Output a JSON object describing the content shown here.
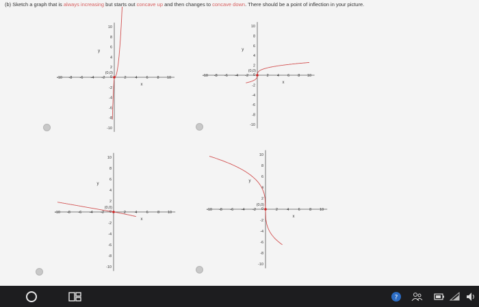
{
  "question": {
    "prefix": "(b) Sketch a graph that is ",
    "part1": "always increasing",
    "mid1": " but starts out ",
    "part2": "concave up",
    "mid2": " and then changes to ",
    "part3": "concave down",
    "suffix": ". There should be a point of inflection in your picture."
  },
  "graphs": [
    {
      "y_ticks_pos": [
        "10",
        "8",
        "6",
        "4",
        "2"
      ],
      "y_ticks_neg": [
        "-2",
        "-4",
        "-6",
        "-8",
        "-10"
      ],
      "x_ticks_neg": [
        "-10",
        "-8",
        "-6",
        "-4",
        "-2"
      ],
      "x_ticks_pos": [
        "2",
        "4",
        "6",
        "8",
        "10"
      ],
      "origin_label": "(0,0)",
      "zero_label": "0",
      "x_axis_label": "x",
      "y_axis_label": "y"
    },
    {
      "y_ticks_pos": [
        "10",
        "8",
        "6",
        "4",
        "2"
      ],
      "y_ticks_neg": [
        "-2",
        "-4",
        "-6",
        "-8",
        "-10"
      ],
      "x_ticks_neg": [
        "-10",
        "-8",
        "-6",
        "-4",
        "-2"
      ],
      "x_ticks_pos": [
        "2",
        "4",
        "6",
        "8",
        "10"
      ],
      "origin_label": "(0,0)",
      "zero_label": "0",
      "x_axis_label": "x",
      "y_axis_label": "y"
    },
    {
      "y_ticks_pos": [
        "10",
        "8",
        "6",
        "4",
        "2"
      ],
      "y_ticks_neg": [
        "-2",
        "-4",
        "-6",
        "-8",
        "-10"
      ],
      "x_ticks_neg": [
        "-10",
        "-8",
        "-6",
        "-4",
        "-2"
      ],
      "x_ticks_pos": [
        "2",
        "4",
        "6",
        "8",
        "10"
      ],
      "origin_label": "(0,0)",
      "zero_label": "0",
      "x_axis_label": "x",
      "y_axis_label": "y"
    },
    {
      "y_ticks_pos": [
        "10",
        "8",
        "6",
        "4",
        "2"
      ],
      "y_ticks_neg": [
        "-2",
        "-4",
        "-6",
        "-8",
        "-10"
      ],
      "x_ticks_neg": [
        "-10",
        "-8",
        "-6",
        "-4",
        "-2"
      ],
      "x_ticks_pos": [
        "2",
        "4",
        "6",
        "8",
        "10"
      ],
      "origin_label": "(0,0)",
      "zero_label": "0",
      "x_axis_label": "x",
      "y_axis_label": "y"
    }
  ],
  "colors": {
    "curve": "#d25050",
    "point": "#cc2222",
    "axis": "#555555",
    "text_highlight": "#d86060"
  },
  "taskbar": {
    "start_icon": "cortana-circle-icon",
    "task_view_icon": "task-view-icon",
    "tray_icons": [
      "help-icon",
      "people-icon",
      "battery-icon",
      "wifi-icon",
      "volume-icon"
    ]
  }
}
